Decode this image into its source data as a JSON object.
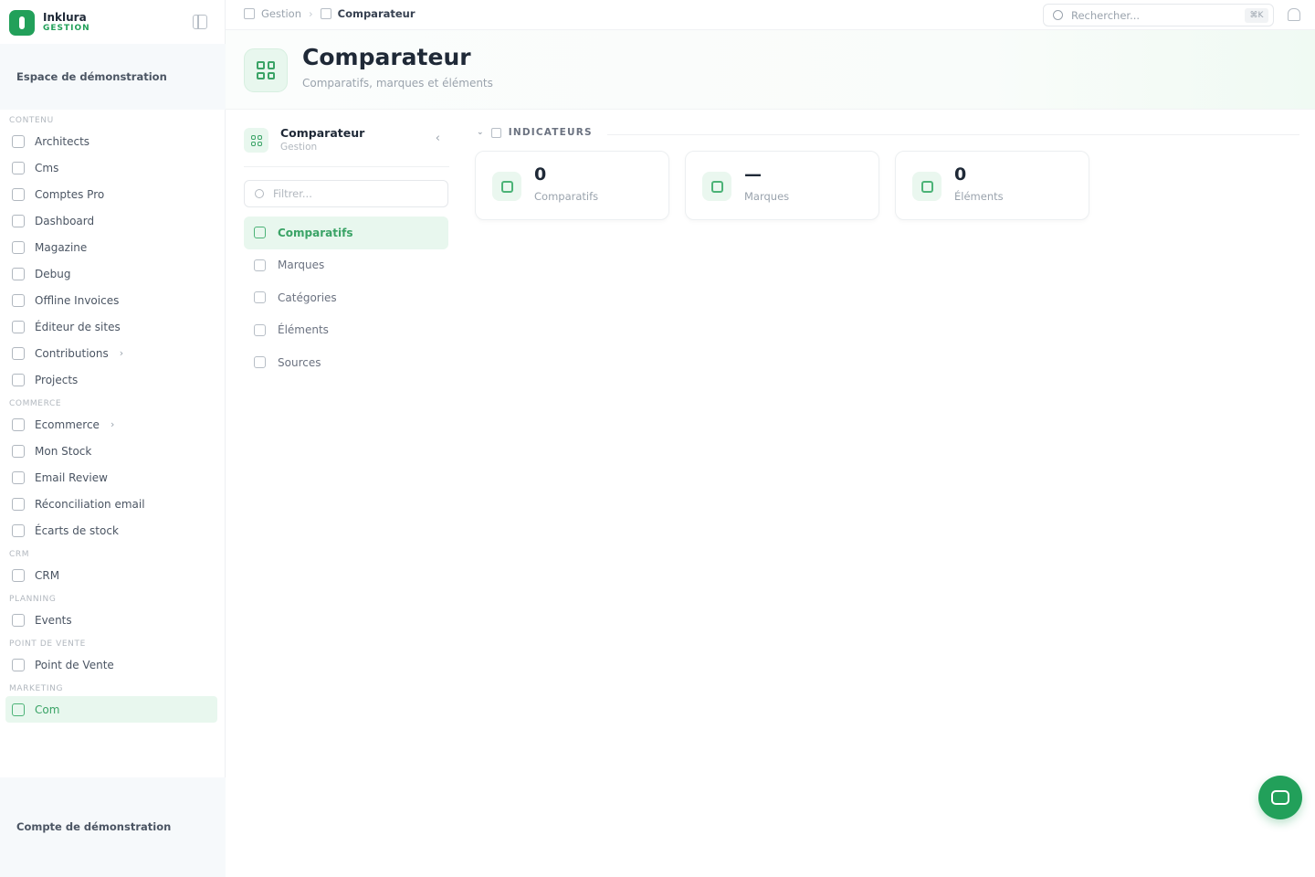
{
  "brand": {
    "name": "Inklura",
    "sub": "GESTION"
  },
  "workspace": "Espace de démonstration",
  "account": "Compte de démonstration",
  "sidebar": {
    "sections": [
      {
        "title": "CONTENU",
        "items": [
          {
            "label": "Architects",
            "icon": "building-icon"
          },
          {
            "label": "Cms",
            "icon": "file-icon"
          },
          {
            "label": "Comptes Pro",
            "icon": "file-icon"
          },
          {
            "label": "Dashboard",
            "icon": "dashboard-icon"
          },
          {
            "label": "Magazine",
            "icon": "book-icon"
          },
          {
            "label": "Debug",
            "icon": "bug-icon"
          },
          {
            "label": "Offline Invoices",
            "icon": "invoice-icon"
          },
          {
            "label": "Éditeur de sites",
            "icon": "terminal-icon"
          },
          {
            "label": "Contributions",
            "icon": "contributions-icon",
            "chevron": true
          },
          {
            "label": "Projects",
            "icon": "folder-icon"
          }
        ]
      },
      {
        "title": "COMMERCE",
        "items": [
          {
            "label": "Ecommerce",
            "icon": "cart-icon",
            "chevron": true
          },
          {
            "label": "Mon Stock",
            "icon": "cart-icon"
          },
          {
            "label": "Email Review",
            "icon": "cart-icon"
          },
          {
            "label": "Réconciliation email",
            "icon": "cart-icon"
          },
          {
            "label": "Écarts de stock",
            "icon": "cart-icon"
          }
        ]
      },
      {
        "title": "CRM",
        "items": [
          {
            "label": "CRM",
            "icon": "user-icon"
          }
        ]
      },
      {
        "title": "PLANNING",
        "items": [
          {
            "label": "Events",
            "icon": "calendar-icon"
          }
        ]
      },
      {
        "title": "POINT DE VENTE",
        "items": [
          {
            "label": "Point de Vente",
            "icon": "store-icon"
          }
        ]
      },
      {
        "title": "MARKETING",
        "items": [
          {
            "label": "Com",
            "icon": "megaphone-icon",
            "active": true
          }
        ]
      }
    ]
  },
  "topbar": {
    "breadcrumb": [
      "Gestion",
      "Comparateur"
    ],
    "search_placeholder": "Rechercher...",
    "search_shortcut": "⌘K"
  },
  "header": {
    "title": "Comparateur",
    "subtitle": "Comparatifs, marques et éléments"
  },
  "panel": {
    "title": "Comparateur",
    "subtitle": "Gestion",
    "filter_placeholder": "Filtrer...",
    "items": [
      {
        "label": "Comparatifs",
        "icon": "grid-icon",
        "active": true
      },
      {
        "label": "Marques",
        "icon": "building-icon"
      },
      {
        "label": "Catégories",
        "icon": "folder-icon"
      },
      {
        "label": "Éléments",
        "icon": "list-icon"
      },
      {
        "label": "Sources",
        "icon": "external-link-icon"
      }
    ]
  },
  "main": {
    "section_title": "INDICATEURS",
    "stats": [
      {
        "value": "0",
        "label": "Comparatifs",
        "icon": "grid-icon"
      },
      {
        "value": "—",
        "label": "Marques",
        "icon": "building-icon"
      },
      {
        "value": "0",
        "label": "Éléments",
        "icon": "list-icon"
      }
    ]
  },
  "colors": {
    "accent": "#22a05a",
    "accent_light": "#e8f7ee"
  }
}
